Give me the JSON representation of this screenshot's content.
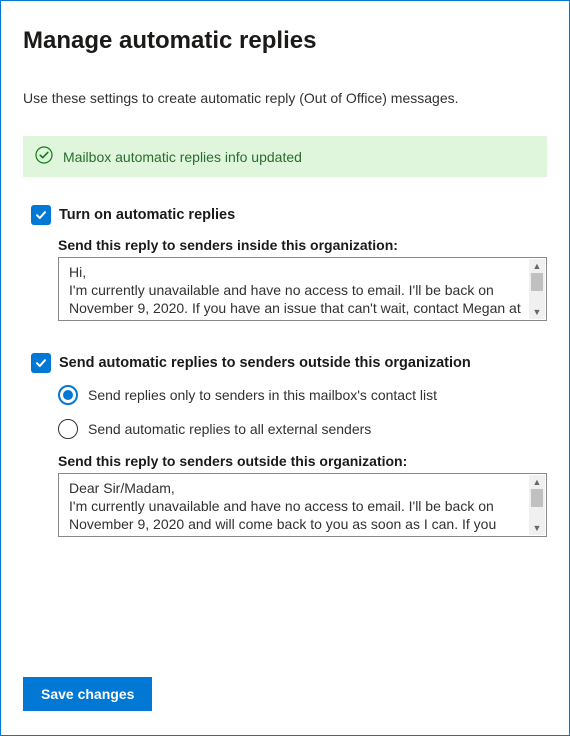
{
  "title": "Manage automatic replies",
  "intro": "Use these settings to create automatic reply (Out of Office) messages.",
  "banner": {
    "text": "Mailbox automatic replies info updated"
  },
  "section_internal": {
    "checkbox_label": "Turn on automatic replies",
    "field_label": "Send this reply to senders inside this organization:",
    "message": "Hi,\nI'm currently unavailable and have no access to email. I'll be back on November 9, 2020. If you have an issue that can't wait, contact Megan at"
  },
  "section_external": {
    "checkbox_label": "Send automatic replies to senders outside this organization",
    "radio_contacts": "Send replies only to senders in this mailbox's contact list",
    "radio_all": "Send automatic replies to all external senders",
    "field_label": "Send this reply to senders outside this organization:",
    "message": "Dear Sir/Madam,\nI'm currently unavailable and have no access to email. I'll be back on November 9, 2020 and will come back to you as soon as I can. If you"
  },
  "save_button": "Save changes"
}
